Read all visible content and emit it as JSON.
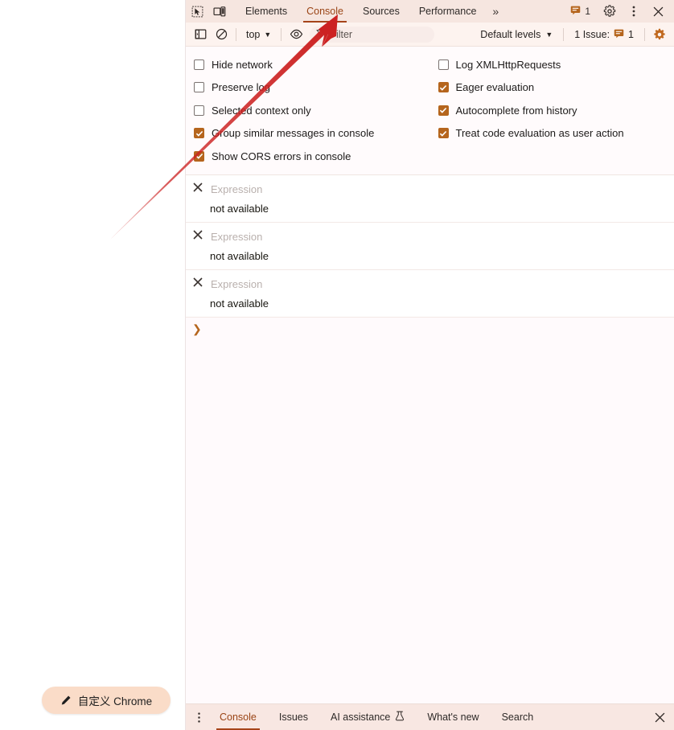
{
  "page": {
    "customize_button": {
      "label": "自定义 Chrome",
      "icon": "pencil-icon"
    }
  },
  "devtools": {
    "tabbar": {
      "inspect_icon": "inspect-element-icon",
      "device_icon": "device-toolbar-icon",
      "tabs": [
        {
          "label": "Elements",
          "active": false
        },
        {
          "label": "Console",
          "active": true
        },
        {
          "label": "Sources",
          "active": false
        },
        {
          "label": "Performance",
          "active": false
        }
      ],
      "more_tabs_label": "»",
      "issues_badge": {
        "icon": "issue-icon",
        "count": "1"
      },
      "settings_icon": "gear-icon",
      "menu_icon": "kebab-menu-icon",
      "close_icon": "close-icon"
    },
    "filterbar": {
      "sidebar_toggle_icon": "console-sidebar-icon",
      "clear_icon": "clear-console-icon",
      "context_value": "top",
      "context_caret": "▼",
      "live_expression_icon": "eye-icon",
      "filter_icon": "filter-funnel-icon",
      "filter_value": "",
      "filter_placeholder": "Filter",
      "levels_value": "Default levels",
      "levels_caret": "▼",
      "issue_text": "1 Issue:",
      "issue_icon": "issue-icon",
      "issue_count": "1",
      "settings_icon": "gear-icon-active"
    },
    "settings": {
      "left_column": [
        {
          "label": "Hide network",
          "checked": false
        },
        {
          "label": "Preserve log",
          "checked": false
        },
        {
          "label": "Selected context only",
          "checked": false
        },
        {
          "label": "Group similar messages in console",
          "checked": true
        },
        {
          "label": "Show CORS errors in console",
          "checked": true
        }
      ],
      "right_column": [
        {
          "label": "Log XMLHttpRequests",
          "checked": false
        },
        {
          "label": "Eager evaluation",
          "checked": true
        },
        {
          "label": "Autocomplete from history",
          "checked": true
        },
        {
          "label": "Treat code evaluation as user action",
          "checked": true
        }
      ]
    },
    "console": {
      "messages": [
        {
          "icon": "error-x-icon",
          "expression": "Expression",
          "body": "not available"
        },
        {
          "icon": "error-x-icon",
          "expression": "Expression",
          "body": "not available"
        },
        {
          "icon": "error-x-icon",
          "expression": "Expression",
          "body": "not available"
        }
      ],
      "prompt_chevron": "❯",
      "prompt_value": ""
    },
    "drawer": {
      "menu_icon": "kebab-menu-icon",
      "tabs": [
        {
          "label": "Console",
          "active": true,
          "icon": ""
        },
        {
          "label": "Issues",
          "active": false,
          "icon": ""
        },
        {
          "label": "AI assistance",
          "active": false,
          "icon": "flask-icon"
        },
        {
          "label": "What's new",
          "active": false,
          "icon": ""
        },
        {
          "label": "Search",
          "active": false,
          "icon": ""
        }
      ],
      "close_icon": "close-icon"
    }
  },
  "annotation": {
    "arrow_color": "#cc2222",
    "arrow_name": "red-pointer-arrow",
    "points_to": "Console"
  },
  "colors": {
    "accent": "#a6441a",
    "tabbar_bg": "#f6e6e0",
    "filterbar_bg": "#fdf3ef",
    "checkbox_checked": "#b5651d",
    "customize_btn_bg": "#fadcc8"
  }
}
